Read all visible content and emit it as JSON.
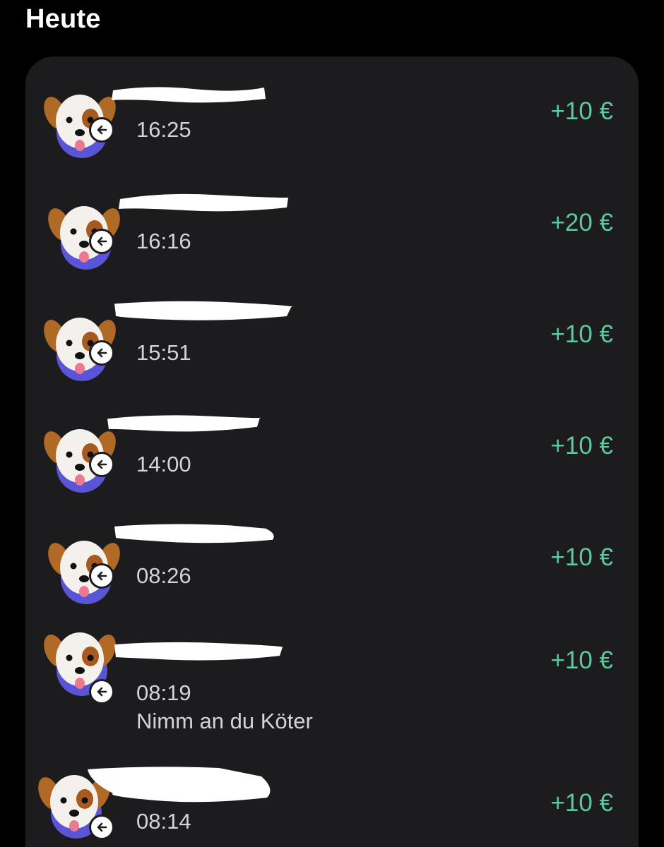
{
  "section": {
    "title": "Heute"
  },
  "transactions": [
    {
      "time": "16:25",
      "amount": "+10 €",
      "note": "",
      "avatar_icon": "dog-face-icon",
      "direction_icon": "incoming-arrow-icon"
    },
    {
      "time": "16:16",
      "amount": "+20 €",
      "note": "",
      "avatar_icon": "dog-face-icon",
      "direction_icon": "incoming-arrow-icon"
    },
    {
      "time": "15:51",
      "amount": "+10 €",
      "note": "",
      "avatar_icon": "dog-face-icon",
      "direction_icon": "incoming-arrow-icon"
    },
    {
      "time": "14:00",
      "amount": "+10 €",
      "note": "",
      "avatar_icon": "dog-face-icon",
      "direction_icon": "incoming-arrow-icon"
    },
    {
      "time": "08:26",
      "amount": "+10 €",
      "note": "",
      "avatar_icon": "dog-face-icon",
      "direction_icon": "incoming-arrow-icon"
    },
    {
      "time": "08:19",
      "amount": "+10 €",
      "note": "Nimm an du Köter",
      "avatar_icon": "dog-face-icon",
      "direction_icon": "incoming-arrow-icon"
    },
    {
      "time": "08:14",
      "amount": "+10 €",
      "note": "",
      "avatar_icon": "dog-face-icon",
      "direction_icon": "incoming-arrow-icon"
    }
  ],
  "colors": {
    "background": "#000000",
    "card": "#1c1c1e",
    "amount_positive": "#5ec79b",
    "secondary_text": "#d4d4d8"
  }
}
